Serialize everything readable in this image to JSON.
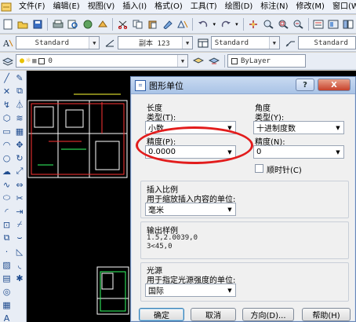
{
  "menubar": {
    "items": [
      "文件(F)",
      "编辑(E)",
      "视图(V)",
      "插入(I)",
      "格式(O)",
      "工具(T)",
      "绘图(D)",
      "标注(N)",
      "修改(M)",
      "窗口(W"
    ]
  },
  "toolbar2": {
    "text_style": "Standard",
    "dim_style": "副本 123",
    "table_style": "Standard",
    "mleader_style": "Standard"
  },
  "toolbar3": {
    "layer": "0",
    "color": "ByLayer"
  },
  "dialog": {
    "title": "图形单位",
    "help_btn": "?",
    "close_btn": "X",
    "length": {
      "group": "长度",
      "type_label": "类型(T):",
      "type_value": "小数",
      "precision_label": "精度(P):",
      "precision_value": "0.0000"
    },
    "angle": {
      "group": "角度",
      "type_label": "类型(Y):",
      "type_value": "十进制度数",
      "precision_label": "精度(N):",
      "precision_value": "0",
      "clockwise_label": "顺时针(C)"
    },
    "insert_scale": {
      "group": "插入比例",
      "label": "用于缩放插入内容的单位:",
      "value": "毫米"
    },
    "output_sample": {
      "group": "输出样例",
      "line1": "1.5,2.0039,0",
      "line2": "3<45,0"
    },
    "light": {
      "group": "光源",
      "label": "用于指定光源强度的单位:",
      "value": "国际"
    },
    "buttons": {
      "ok": "确定",
      "cancel": "取消",
      "direction": "方向(D)...",
      "help": "帮助(H)"
    }
  },
  "colors": {
    "highlight_circle": "#e21c1c",
    "canvas_bg": "#000000"
  }
}
